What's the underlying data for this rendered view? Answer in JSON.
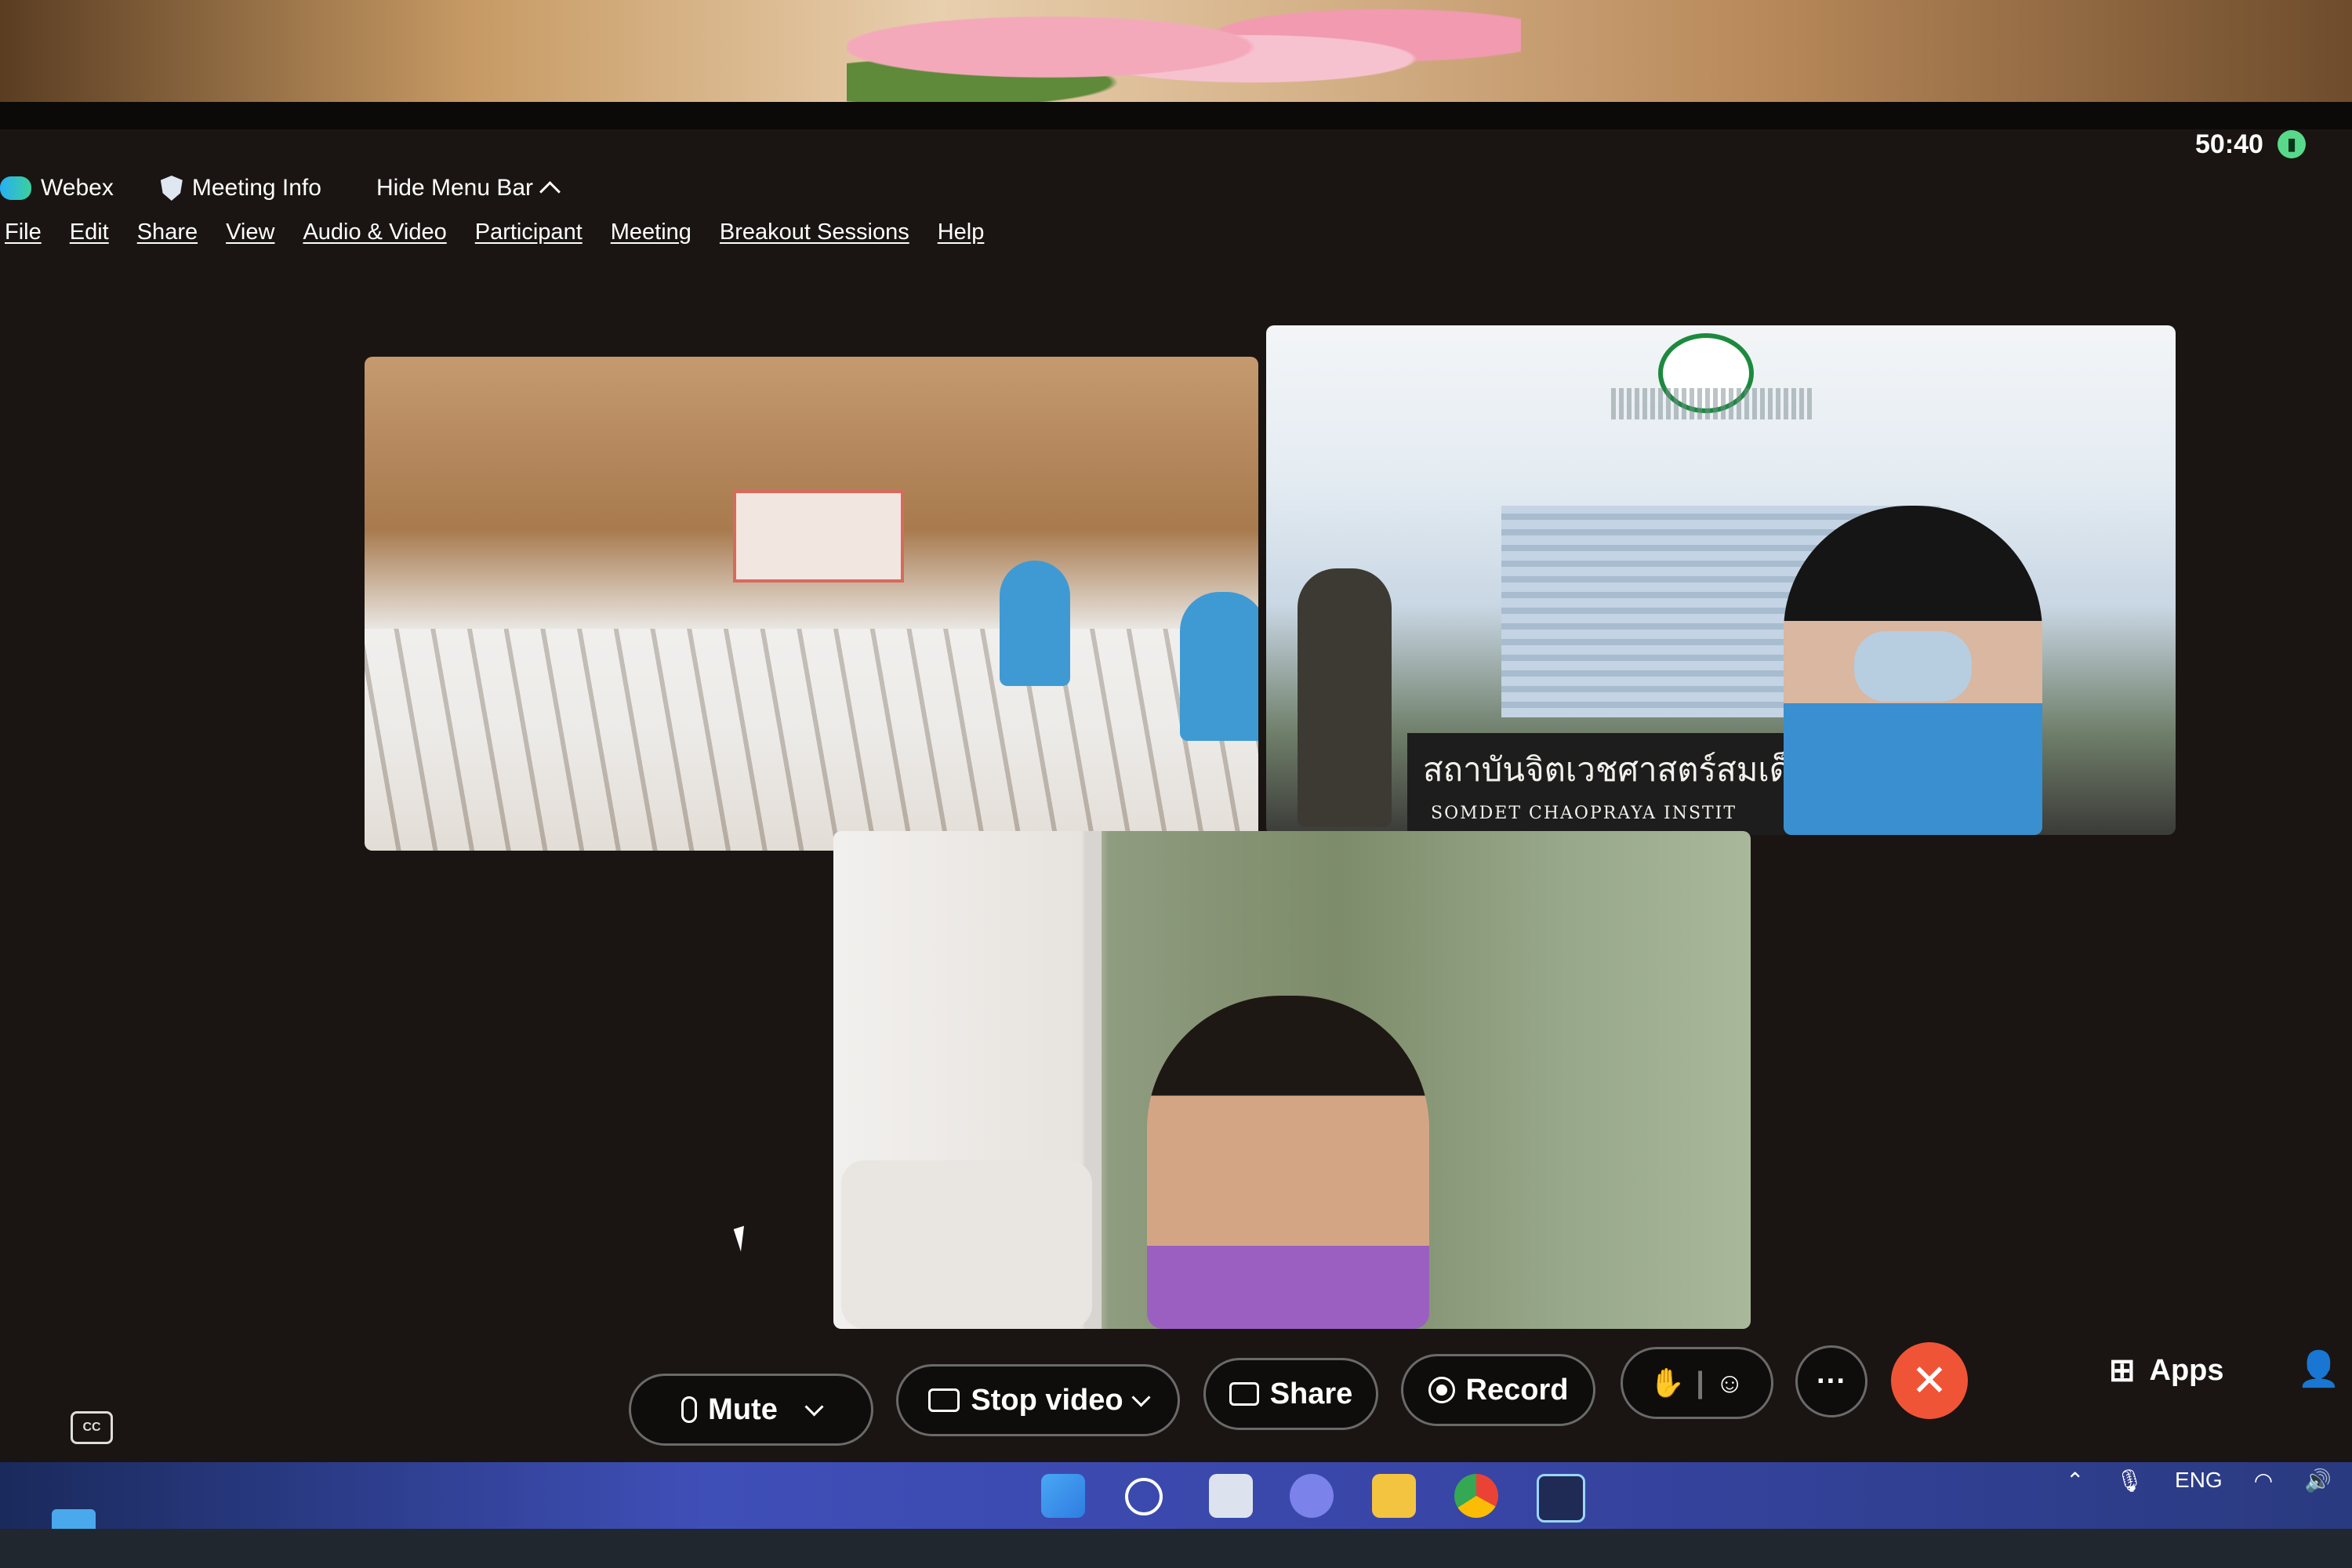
{
  "status": {
    "timer": "50:40"
  },
  "topbar": {
    "app_name": "Webex",
    "meeting_info": "Meeting Info",
    "hide_menu_bar": "Hide Menu Bar"
  },
  "menubar": [
    "File",
    "Edit",
    "Share",
    "View",
    "Audio & Video",
    "Participant",
    "Meeting",
    "Breakout Sessions",
    "Help"
  ],
  "videos": {
    "tile2_sign": "สถาบันจิตเวชศาสตร์สมเด็",
    "tile2_sign_sub": "SOMDET CHAOPRAYA INSTIT"
  },
  "controls": {
    "mute": "Mute",
    "stop_video": "Stop video",
    "share": "Share",
    "record": "Record",
    "more": "···",
    "leave": "✕",
    "apps": "Apps",
    "cc": "CC"
  },
  "tray": {
    "language": "ENG"
  },
  "colors": {
    "leave": "#f05437",
    "taskbar": "#3f4fb8",
    "accent": "#27b0f5"
  }
}
